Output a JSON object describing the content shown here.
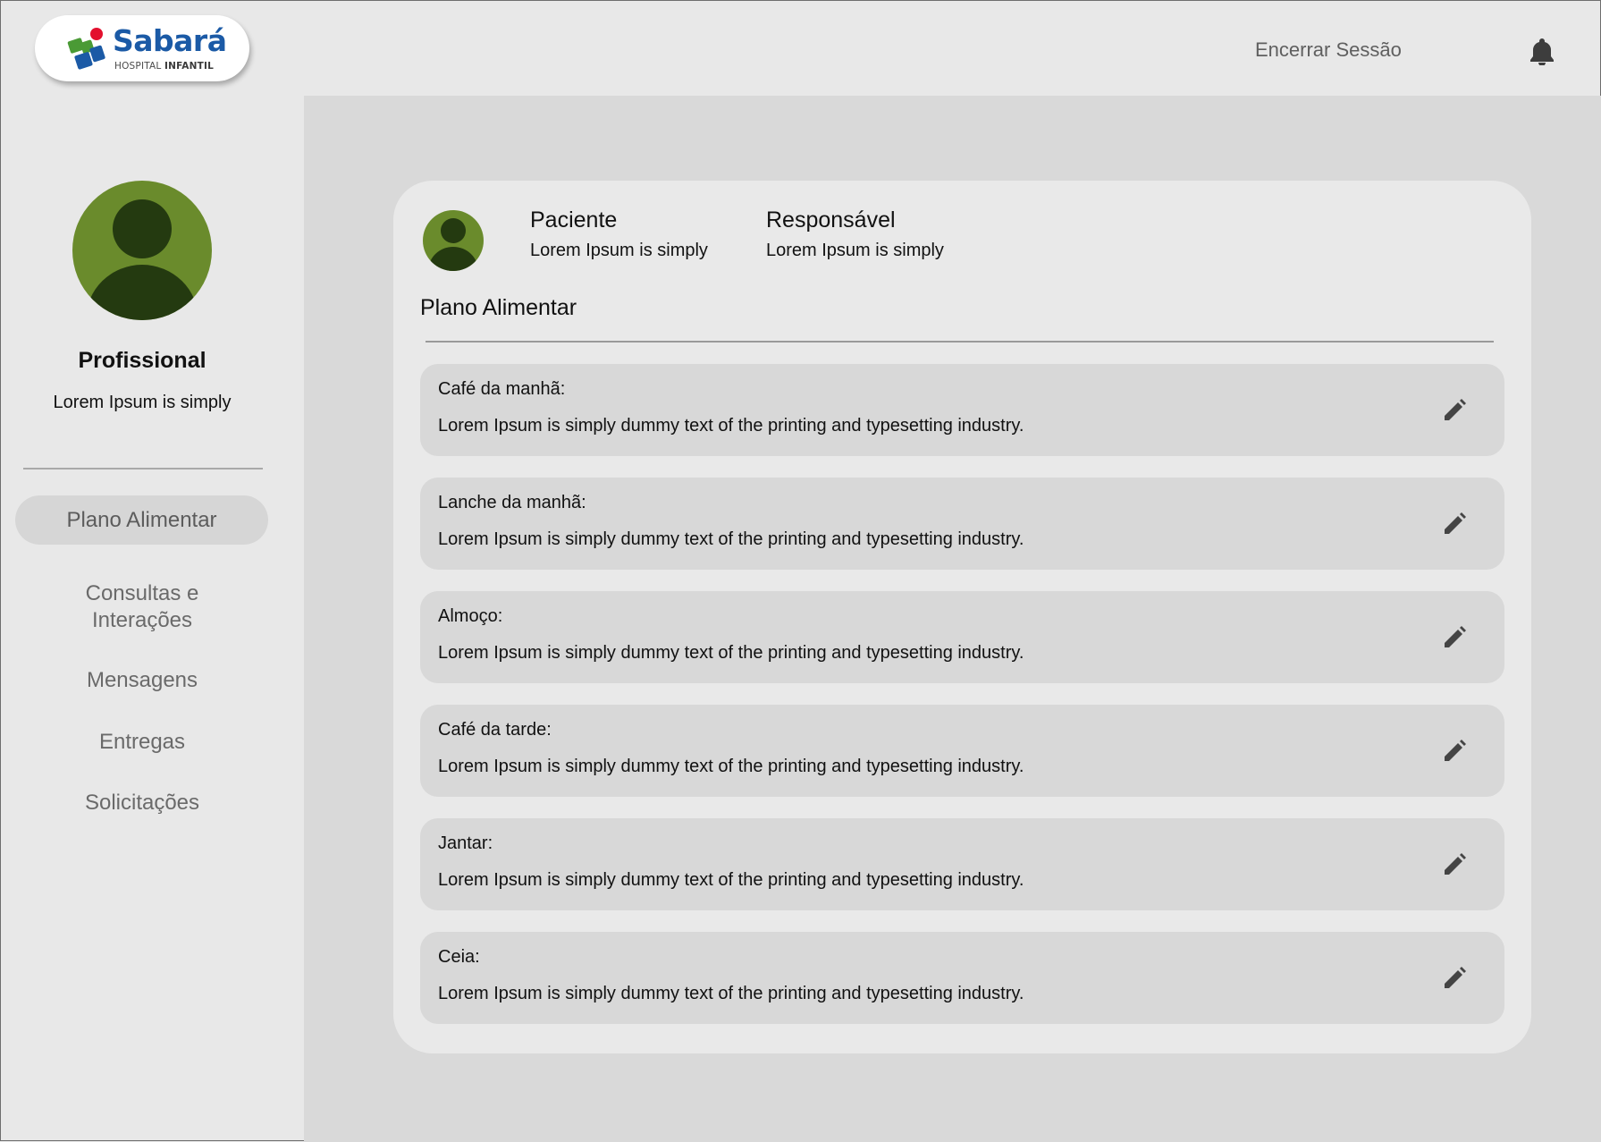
{
  "brand": {
    "name": "Sabará",
    "sub_left": "HOSPITAL",
    "sub_right": "INFANTIL",
    "colors": {
      "blue": "#1b5aa6",
      "green": "#4a9a35",
      "red": "#e3102e"
    }
  },
  "header": {
    "logout_label": "Encerrar Sessão",
    "bell_icon": "bell-icon"
  },
  "sidebar": {
    "profile_title": "Profissional",
    "profile_subtitle": "Lorem Ipsum is simply",
    "avatar_color": "#6a8b2c",
    "items": [
      {
        "label": "Plano Alimentar",
        "active": true
      },
      {
        "label": "Consultas e Interações",
        "active": false
      },
      {
        "label": "Mensagens",
        "active": false
      },
      {
        "label": "Entregas",
        "active": false
      },
      {
        "label": "Solicitações",
        "active": false
      }
    ]
  },
  "card": {
    "patient_label": "Paciente",
    "patient_value": "Lorem Ipsum is simply",
    "guardian_label": "Responsável",
    "guardian_value": "Lorem Ipsum is simply",
    "section_title": "Plano Alimentar",
    "meals": [
      {
        "title": "Café da manhã:",
        "text": "Lorem Ipsum is simply dummy text of the printing and typesetting industry."
      },
      {
        "title": "Lanche da manhã:",
        "text": "Lorem Ipsum is simply dummy text of the printing and typesetting industry."
      },
      {
        "title": "Almoço:",
        "text": "Lorem Ipsum is simply dummy text of the printing and typesetting industry."
      },
      {
        "title": "Café da tarde:",
        "text": "Lorem Ipsum is simply dummy text of the printing and typesetting industry."
      },
      {
        "title": "Jantar:",
        "text": "Lorem Ipsum is simply dummy text of the printing and typesetting industry."
      },
      {
        "title": "Ceia:",
        "text": "Lorem Ipsum is simply dummy text of the printing and typesetting industry."
      }
    ]
  },
  "colors": {
    "page_bg": "#e8e8e8",
    "main_bg": "#d9d9d9",
    "card_bg": "#e9e9e9",
    "meal_bg": "#d8d8d8",
    "nav_active_bg": "#d6d6d6"
  }
}
